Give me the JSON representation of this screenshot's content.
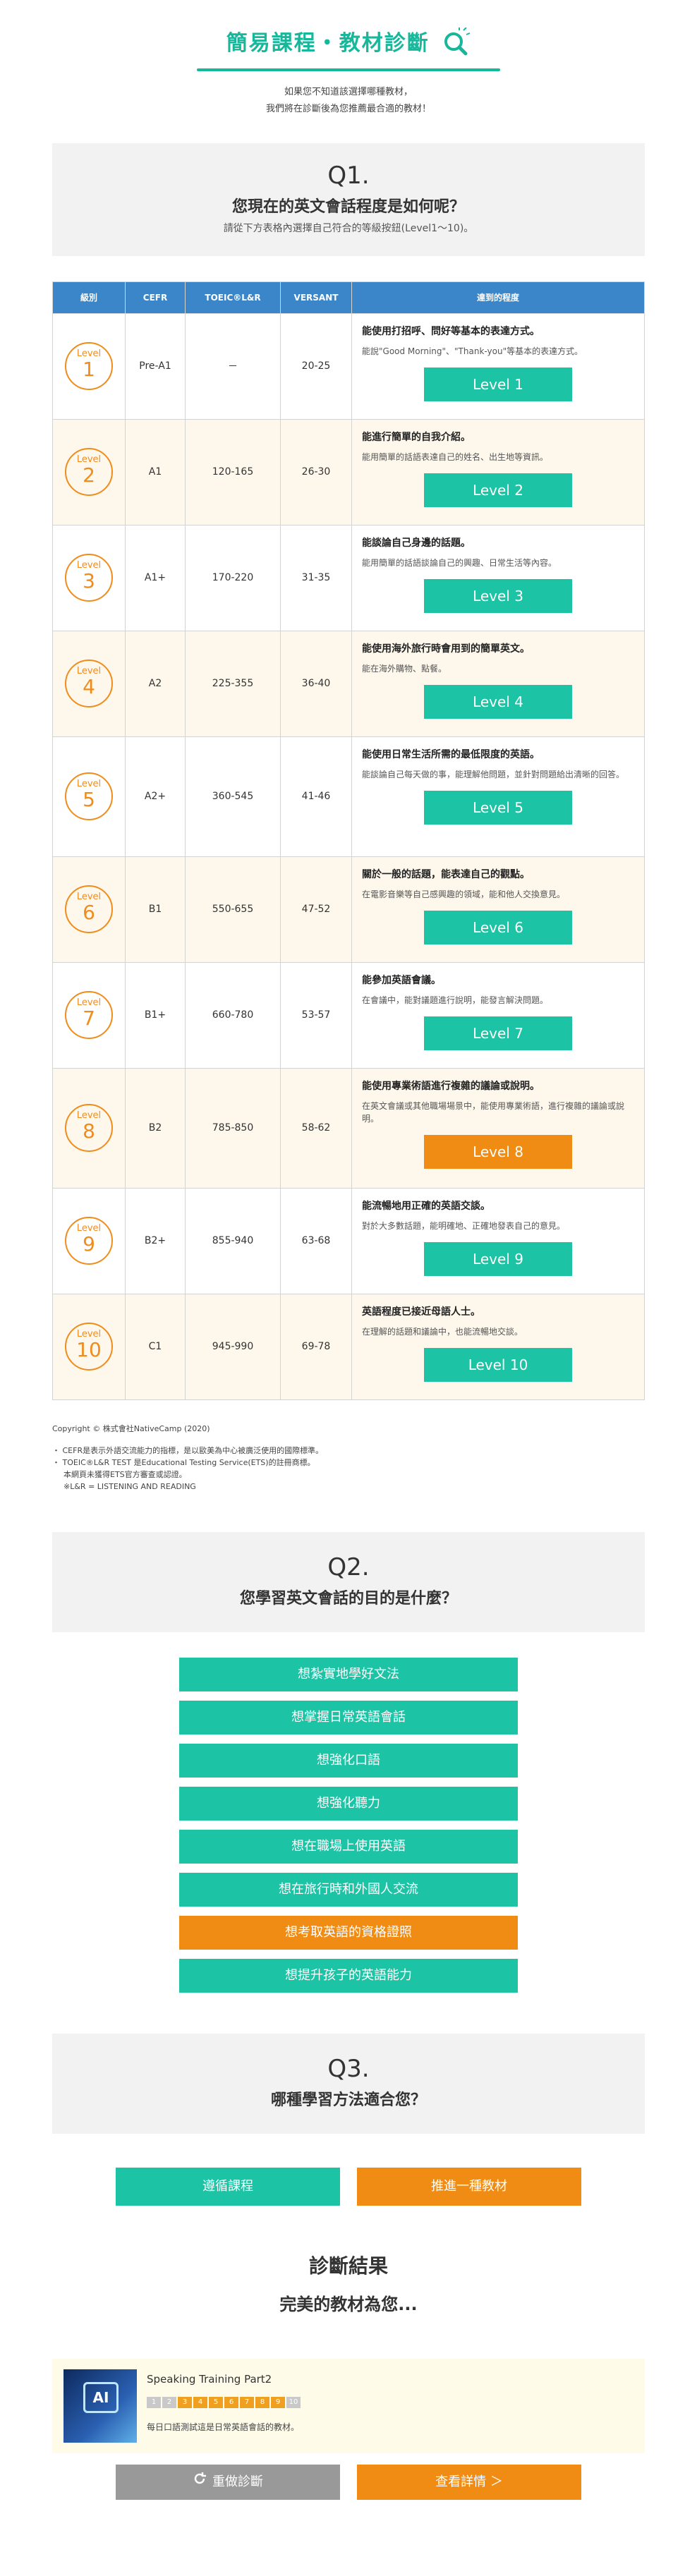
{
  "header": {
    "title": "簡易課程・教材診斷",
    "sub1": "如果您不知道該選擇哪種教材，",
    "sub2": "我們將在診斷後為您推薦最合適的教材！"
  },
  "q1": {
    "num": "Q1.",
    "text": "您現在的英文會話程度是如何呢？",
    "note": "請從下方表格內選擇自己符合的等級按鈕(Level1〜10)。",
    "columns": [
      "級別",
      "CEFR",
      "TOEIC®L&R",
      "VERSANT",
      "達到的程度"
    ],
    "level_word": "Level",
    "rows": [
      {
        "n": "1",
        "cefr": "Pre-A1",
        "toeic": "－",
        "versant": "20-25",
        "title": "能使用打招呼、問好等基本的表達方式。",
        "text": "能說\"Good Morning\"、\"Thank-you\"等基本的表達方式。",
        "btn": "Level 1"
      },
      {
        "n": "2",
        "cefr": "A1",
        "toeic": "120-165",
        "versant": "26-30",
        "title": "能進行簡單的自我介紹。",
        "text": "能用簡單的話語表達自己的姓名、出生地等資訊。",
        "btn": "Level 2"
      },
      {
        "n": "3",
        "cefr": "A1+",
        "toeic": "170-220",
        "versant": "31-35",
        "title": "能談論自己身邊的話題。",
        "text": "能用簡單的話語談論自己的興趣、日常生活等內容。",
        "btn": "Level 3"
      },
      {
        "n": "4",
        "cefr": "A2",
        "toeic": "225-355",
        "versant": "36-40",
        "title": "能使用海外旅行時會用到的簡單英文。",
        "text": "能在海外購物、點餐。",
        "btn": "Level 4"
      },
      {
        "n": "5",
        "cefr": "A2+",
        "toeic": "360-545",
        "versant": "41-46",
        "title": "能使用日常生活所需的最低限度的英語。",
        "text": "能談論自己每天做的事，能理解他問題，並針對問題給出清晰的回答。",
        "btn": "Level 5"
      },
      {
        "n": "6",
        "cefr": "B1",
        "toeic": "550-655",
        "versant": "47-52",
        "title": "關於一般的話題，能表達自己的觀點。",
        "text": "在電影音樂等自己感興趣的領域，能和他人交換意見。",
        "btn": "Level 6"
      },
      {
        "n": "7",
        "cefr": "B1+",
        "toeic": "660-780",
        "versant": "53-57",
        "title": "能參加英語會議。",
        "text": "在會議中，能對議題進行說明，能發言解決問題。",
        "btn": "Level 7"
      },
      {
        "n": "8",
        "cefr": "B2",
        "toeic": "785-850",
        "versant": "58-62",
        "title": "能使用專業術語進行複雜的議論或說明。",
        "text": "在英文會議或其他職場場景中，能使用專業術語，進行複雜的議論或說明。",
        "btn": "Level 8"
      },
      {
        "n": "9",
        "cefr": "B2+",
        "toeic": "855-940",
        "versant": "63-68",
        "title": "能流暢地用正確的英語交談。",
        "text": "對於大多數話題，能明確地、正確地發表自己的意見。",
        "btn": "Level 9"
      },
      {
        "n": "10",
        "cefr": "C1",
        "toeic": "945-990",
        "versant": "69-78",
        "title": "英語程度已接近母語人士。",
        "text": "在理解的話題和議論中，也能流暢地交談。",
        "btn": "Level 10"
      }
    ],
    "selected_level": "8"
  },
  "notes": {
    "copyright": "Copyright © 株式會社NativeCamp (2020)",
    "note1": "・ CEFR是表示外語交流能力的指標，是以歐美為中心被廣泛使用的國際標準。",
    "note2": "・ TOEIC®L&R TEST 是Educational Testing Service(ETS)的註冊商標。",
    "note3": "本網頁未獲得ETS官方審查或認證。",
    "note4": "※L&R = LISTENING AND READING"
  },
  "q2": {
    "num": "Q2.",
    "text": "您學習英文會話的目的是什麼？",
    "options": [
      "想紮實地學好文法",
      "想掌握日常英語會話",
      "想強化口語",
      "想強化聽力",
      "想在職場上使用英語",
      "想在旅行時和外國人交流",
      "想考取英語的資格證照",
      "想提升孩子的英語能力"
    ],
    "selected_index": 6
  },
  "q3": {
    "num": "Q3.",
    "text": "哪種學習方法適合您？",
    "options": [
      "遵循課程",
      "推進一種教材"
    ],
    "selected_index": 1
  },
  "result": {
    "title": "診斷結果",
    "sub": "完美的教材為您...",
    "card": {
      "name": "Speaking Training Part2",
      "image_text": "AI",
      "levels": [
        "1",
        "2",
        "3",
        "4",
        "5",
        "6",
        "7",
        "8",
        "9",
        "10"
      ],
      "active_levels": [
        3,
        4,
        5,
        6,
        7,
        8,
        9
      ],
      "desc": "每日口語測試這是日常英語會話的教材。"
    }
  },
  "bottom": {
    "retry": "重做診斷",
    "detail": "查看詳情 ＞"
  },
  "colors": {
    "teal": "#1cc3a4",
    "orange": "#f08c14",
    "blue": "#3a86c8"
  }
}
